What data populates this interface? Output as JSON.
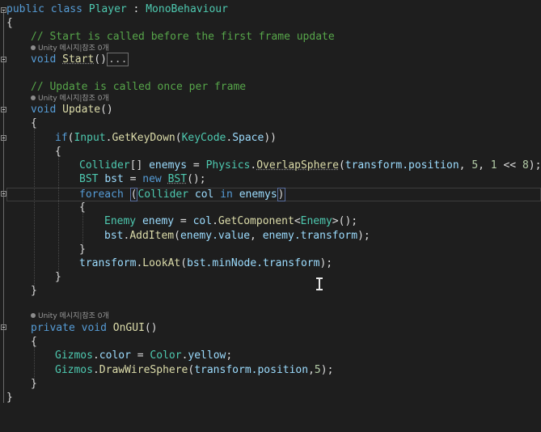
{
  "codelens": {
    "unity_refs": "Unity 메시지|참조 0개"
  },
  "code": {
    "class_kw1": "public",
    "class_kw2": "class",
    "class_name": "Player",
    "colon": " : ",
    "base_class": "MonoBehaviour",
    "open_brace": "{",
    "close_brace": "}",
    "comment_start": "// Start is called before the first frame update",
    "void_kw": "void",
    "start_name": "Start",
    "parens": "()",
    "collapsed_marker": "...",
    "comment_update": "// Update is called once per frame",
    "update_name": "Update",
    "if_kw": "if",
    "input_cls": "Input",
    "getkeydown": "GetKeyDown",
    "keycode_cls": "KeyCode",
    "space": "Space",
    "collider_t": "Collider",
    "enemys_var": "enemys",
    "physics_cls": "Physics",
    "overlap": "OverlapSphere",
    "transform_pos": "transform.position",
    "num5": "5",
    "num1": "1",
    "shift": " << ",
    "num8": "8",
    "bst_t": "BST",
    "bst_var": "bst",
    "new_kw": "new",
    "foreach_kw": "foreach",
    "col_var": "col",
    "in_kw": "in",
    "enemy_t": "Enemy",
    "enemy_var": "enemy",
    "getcomponent": "GetComponent",
    "additem": "AddItem",
    "enemy_value": "enemy.value",
    "enemy_transform": "enemy.transform",
    "lookat": "LookAt",
    "minnode": "bst.minNode.transform",
    "private_kw": "private",
    "ongui": "OnGUI",
    "gizmos_cls": "Gizmos",
    "color_prop": "color",
    "color_cls": "Color",
    "yellow": "yellow",
    "drawwire": "DrawWireSphere",
    "num5b": "5"
  }
}
